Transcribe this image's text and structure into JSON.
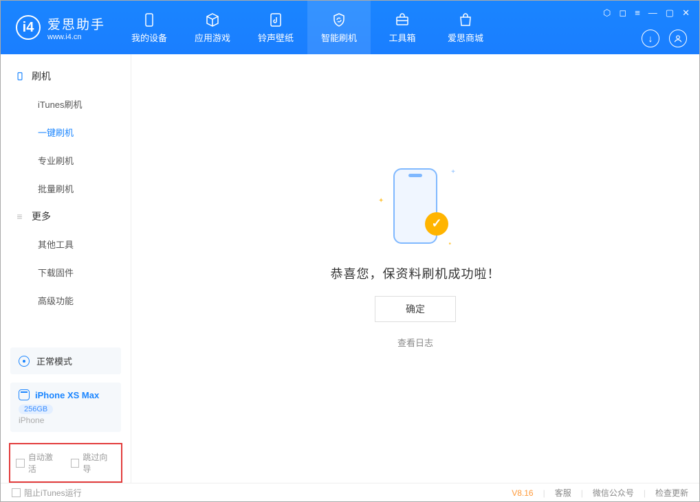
{
  "header": {
    "app_name": "爱思助手",
    "app_url": "www.i4.cn",
    "tabs": [
      {
        "label": "我的设备"
      },
      {
        "label": "应用游戏"
      },
      {
        "label": "铃声壁纸"
      },
      {
        "label": "智能刷机"
      },
      {
        "label": "工具箱"
      },
      {
        "label": "爱思商城"
      }
    ]
  },
  "sidebar": {
    "section_flash": "刷机",
    "items_flash": [
      "iTunes刷机",
      "一键刷机",
      "专业刷机",
      "批量刷机"
    ],
    "section_more": "更多",
    "items_more": [
      "其他工具",
      "下载固件",
      "高级功能"
    ],
    "mode_label": "正常模式",
    "device_name": "iPhone XS Max",
    "device_badge": "256GB",
    "device_type": "iPhone",
    "check_auto_activate": "自动激活",
    "check_skip_guide": "跳过向导"
  },
  "content": {
    "success_msg": "恭喜您，保资料刷机成功啦！",
    "ok_btn": "确定",
    "view_log": "查看日志"
  },
  "footer": {
    "block_itunes": "阻止iTunes运行",
    "version": "V8.16",
    "link_service": "客服",
    "link_wechat": "微信公众号",
    "link_update": "检查更新"
  }
}
